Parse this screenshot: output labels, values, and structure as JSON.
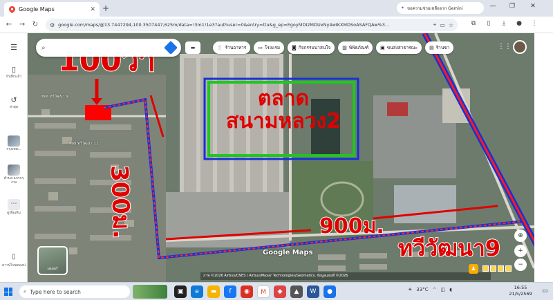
{
  "browser": {
    "tab_title": "Google Maps",
    "new_tab": "+",
    "gemini_label": "ขอความช่วยเหลือจาก Gemini",
    "url": "google.com/maps/@13.7447294,100.3507447,625m/data=!3m1!1e3?authuser=0&entry=ttu&g_ep=EgoyMDI2MDUxNy4wIKXMDSoASAFQAw%3..."
  },
  "map": {
    "filters": [
      {
        "icon": "restaurant-icon",
        "label": "ร้านอาหาร"
      },
      {
        "icon": "hotel-icon",
        "label": "โรงแรม"
      },
      {
        "icon": "camera-icon",
        "label": "กิจกรรมน่าสนใจ"
      },
      {
        "icon": "museum-icon",
        "label": "พิพิธภัณฑ์"
      },
      {
        "icon": "transit-icon",
        "label": "ขนส่งสาธารณะ"
      },
      {
        "icon": "shopping-icon",
        "label": "ร้านขา"
      }
    ],
    "logo": "Google Maps",
    "attribution": "ภาพ ©2026 Airbus/CNES / Airbus/Maxar Technologies/Geomatics, ข้อมูลแผนที่ ©2026",
    "layer_label": "เลเยอร์",
    "labels": {
      "street1": "ซอย ทวีวัฒนา 9",
      "street2": "ซอย ทวีวัฒนา 11"
    }
  },
  "left_rail": [
    {
      "icon": "bookmark-icon",
      "label": "บันทึกแล้ว"
    },
    {
      "icon": "history-icon",
      "label": "ล่าสุด"
    },
    {
      "icon": "thumb-icon",
      "label": "กรุงเทพ..."
    },
    {
      "icon": "thumb-icon",
      "label": "ตำบล แกรกรุงาม"
    },
    {
      "icon": "more-icon",
      "label": "ดูเพิ่มเติม"
    },
    {
      "icon": "phone-icon",
      "label": "ดาวน์โหลดแอป"
    }
  ],
  "annotations": {
    "plot_size": "100วา",
    "side_distance": "300ม.",
    "road_distance": "900ม.",
    "road_name": "ทวีวัฒนา9",
    "market_line1": "ตลาด",
    "market_line2": "สนามหลวง2"
  },
  "taskbar": {
    "search_placeholder": "Type here to search",
    "temperature": "33°C",
    "time": "16:55",
    "date": "21/5/2569"
  },
  "colors": {
    "annotation_red": "#e00000",
    "route_blue": "#1a2fd6",
    "market_green": "#1ec81e"
  }
}
